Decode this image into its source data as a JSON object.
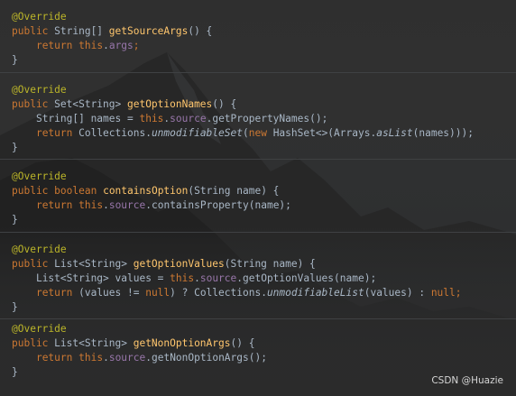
{
  "watermark": "CSDN @Huazie",
  "m1": {
    "annotation": "@Override",
    "sig_kw": "public",
    "sig_type": " String[] ",
    "sig_name": "getSourceArgs",
    "sig_rest": "() {",
    "b_kw": "return",
    "b_this": "this",
    "b_dot": ".",
    "b_fld": "args",
    "b_end": ";",
    "close": "}"
  },
  "m2": {
    "annotation": "@Override",
    "sig_kw": "public",
    "sig_type": " Set<String> ",
    "sig_name": "getOptionNames",
    "sig_rest": "() {",
    "l1_a": "String[] names = ",
    "l1_this": "this",
    "l1_dot": ".",
    "l1_fld": "source",
    "l1_rest": ".getPropertyNames();",
    "l2_kw": "return",
    "l2_a": " Collections.",
    "l2_it": "unmodifiableSet",
    "l2_b": "(",
    "l2_new": "new",
    "l2_c": " HashSet<>(Arrays.",
    "l2_it2": "asList",
    "l2_d": "(names)));",
    "close": "}"
  },
  "m3": {
    "annotation": "@Override",
    "sig_kw": "public",
    "sig_bool": "boolean",
    "sig_name": "containsOption",
    "sig_rest": "(String name) {",
    "b_kw": "return",
    "b_this": "this",
    "b_dot": ".",
    "b_fld": "source",
    "b_rest": ".containsProperty(name);",
    "close": "}"
  },
  "m4": {
    "annotation": "@Override",
    "sig_kw": "public",
    "sig_type": " List<String> ",
    "sig_name": "getOptionValues",
    "sig_rest": "(String name) {",
    "l1_a": "List<String> values = ",
    "l1_this": "this",
    "l1_dot": ".",
    "l1_fld": "source",
    "l1_rest": ".getOptionValues(name);",
    "l2_kw": "return",
    "l2_a": " (values != ",
    "l2_null": "null",
    "l2_b": ") ? Collections.",
    "l2_it": "unmodifiableList",
    "l2_c": "(values) : ",
    "l2_null2": "null",
    "l2_end": ";",
    "close": "}"
  },
  "m5": {
    "annotation": "@Override",
    "sig_kw": "public",
    "sig_type": " List<String> ",
    "sig_name": "getNonOptionArgs",
    "sig_rest": "() {",
    "b_kw": "return",
    "b_this": "this",
    "b_dot": ".",
    "b_fld": "source",
    "b_rest": ".getNonOptionArgs();",
    "close": "}"
  }
}
